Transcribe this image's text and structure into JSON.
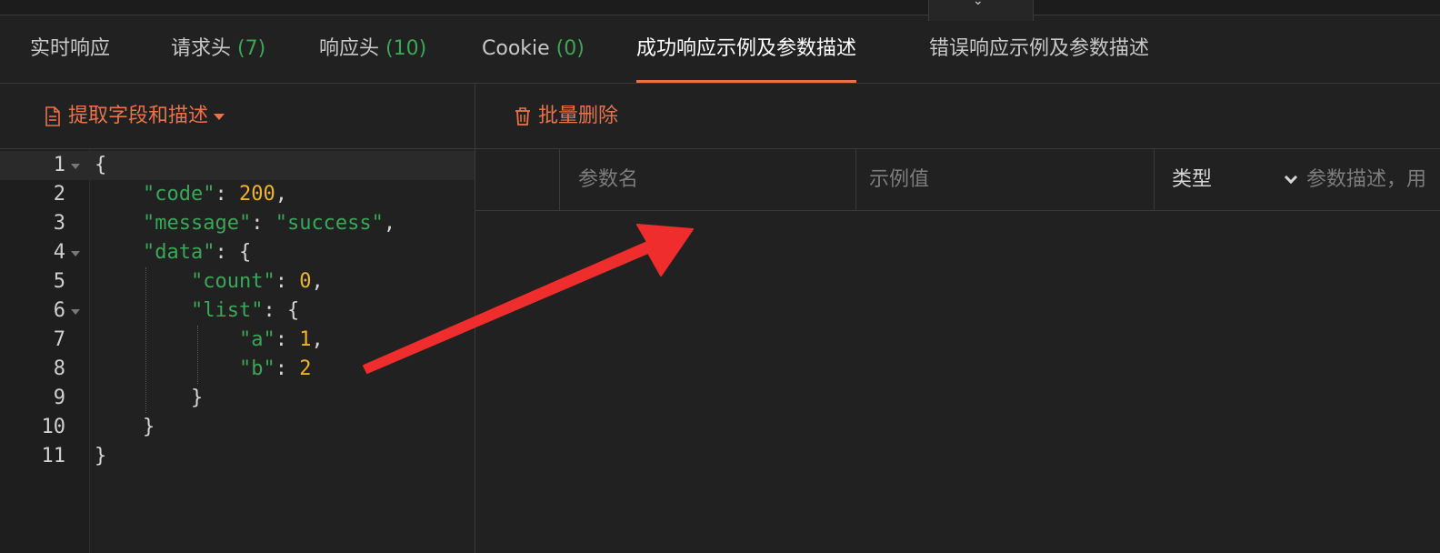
{
  "tabs": [
    {
      "label": "实时响应",
      "count": ""
    },
    {
      "label": "请求头",
      "count": "(7)"
    },
    {
      "label": "响应头",
      "count": "(10)"
    },
    {
      "label": "Cookie",
      "count": "(0)"
    },
    {
      "label": "成功响应示例及参数描述",
      "count": ""
    },
    {
      "label": "错误响应示例及参数描述",
      "count": ""
    }
  ],
  "active_tab": "成功响应示例及参数描述",
  "left_toolbar": {
    "extract_label": "提取字段和描述",
    "extract_icon": "document-icon"
  },
  "right_toolbar": {
    "bulk_delete_label": "批量删除",
    "bulk_delete_icon": "trash-icon"
  },
  "editor": {
    "line_numbers": [
      "1",
      "2",
      "3",
      "4",
      "5",
      "6",
      "7",
      "8",
      "9",
      "10",
      "11"
    ],
    "lines": [
      "{",
      "    \"code\": 200,",
      "    \"message\": \"success\",",
      "    \"data\": {",
      "        \"count\": 0,",
      "        \"list\": {",
      "            \"a\": 1,",
      "            \"b\": 2",
      "        }",
      "    }",
      "}"
    ]
  },
  "table": {
    "columns": {
      "name": "参数名",
      "example": "示例值",
      "type": "类型",
      "desc": "参数描述，用"
    }
  },
  "colors": {
    "accent": "#e8734a",
    "green": "#3aa757",
    "number": "#f0b429",
    "arrow": "#f02d2d",
    "background": "#212121"
  }
}
